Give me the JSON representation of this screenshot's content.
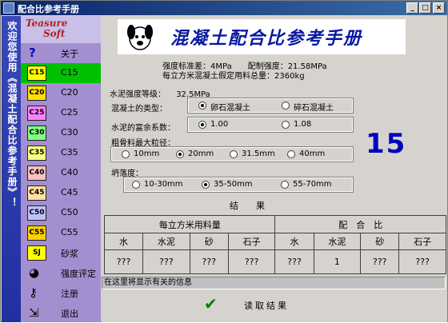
{
  "window": {
    "title": "配合比参考手册",
    "min": "_",
    "max": "□",
    "close": "×"
  },
  "banner": {
    "text": "欢迎您使用《混凝土配合比参考手册》！"
  },
  "sidebar": {
    "logo_line1": "Teasure",
    "logo_line2": "Soft",
    "items": [
      {
        "icon": "?",
        "label": "关于"
      },
      {
        "icon": "C15",
        "label": "C15",
        "active": true
      },
      {
        "icon": "C20",
        "label": "C20"
      },
      {
        "icon": "C25",
        "label": "C25"
      },
      {
        "icon": "C30",
        "label": "C30"
      },
      {
        "icon": "C35",
        "label": "C35"
      },
      {
        "icon": "C40",
        "label": "C40"
      },
      {
        "icon": "C45",
        "label": "C45"
      },
      {
        "icon": "C50",
        "label": "C50"
      },
      {
        "icon": "C55",
        "label": "C55"
      },
      {
        "icon": "SJ",
        "label": "砂浆"
      },
      {
        "icon": "eval-icon",
        "label": "强度评定"
      },
      {
        "icon": "key-icon",
        "label": "注册"
      },
      {
        "icon": "exit-icon",
        "label": "退出"
      }
    ]
  },
  "header": {
    "title": "混凝土配合比参考手册"
  },
  "info": {
    "line1": "强度标准差：4MPa　　配制强度：21.58MPa",
    "line2": "每立方米混凝土假定用料总量：2360kg"
  },
  "cement_grade": {
    "label": "水泥强度等级：",
    "value": "32.5MPa"
  },
  "concrete_type": {
    "label": "混凝土的类型：",
    "options": [
      "卵石混凝土",
      "碎石混凝土"
    ],
    "selected": 0
  },
  "surplus": {
    "label": "水泥的富余系数：",
    "options": [
      "1.00",
      "1.08"
    ],
    "selected": 0
  },
  "aggregate": {
    "label": "粗骨料最大粒径：",
    "options": [
      "10mm",
      "20mm",
      "31.5mm",
      "40mm"
    ],
    "selected": 1
  },
  "slump": {
    "label": "坍落度：",
    "options": [
      "10-30mm",
      "35-50mm",
      "55-70mm"
    ],
    "selected": 1
  },
  "grade_display": "15",
  "results": {
    "title": "结　　果",
    "group1": "每立方米用料量",
    "group2": "配　合　比",
    "headers": [
      "水",
      "水泥",
      "砂",
      "石子",
      "水",
      "水泥",
      "砂",
      "石子"
    ],
    "values": [
      "???",
      "???",
      "???",
      "???",
      "???",
      "1",
      "???",
      "???"
    ]
  },
  "status": "在这里将显示有关的信息",
  "read_button": "读取结果",
  "colors": {
    "titlebar": "#0a246a",
    "sidebar": "#a38fd0",
    "active": "#00c000",
    "header_text": "#0818a0"
  }
}
